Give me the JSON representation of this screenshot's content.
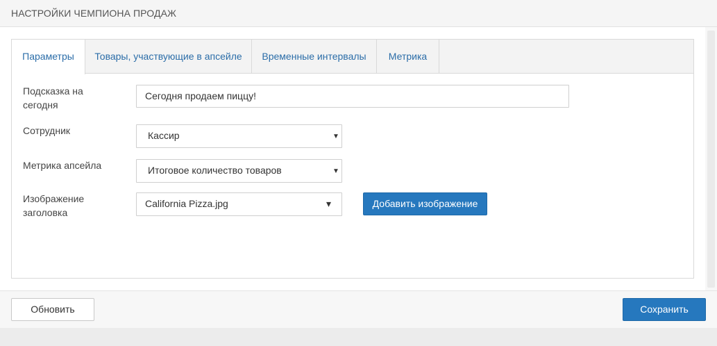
{
  "panel": {
    "title": "НАСТРОЙКИ ЧЕМПИОНА ПРОДАЖ"
  },
  "tabs": [
    {
      "label": "Параметры",
      "active": true
    },
    {
      "label": "Товары, участвующие в апсейле",
      "active": false
    },
    {
      "label": "Временные интервалы",
      "active": false
    },
    {
      "label": "Метрика",
      "active": false
    }
  ],
  "form": {
    "hint_label_line1": "Подсказка на",
    "hint_label_line2": "сегодня",
    "hint_value": "Сегодня продаем пиццу!",
    "employee_label": "Сотрудник",
    "employee_value": "Кассир",
    "metric_label": "Метрика апсейла",
    "metric_value": "Итоговое количество товаров",
    "image_label_line1": "Изображение",
    "image_label_line2": "заголовка",
    "image_value": "California Pizza.jpg",
    "add_image_label": "Добавить изображение"
  },
  "footer": {
    "refresh_label": "Обновить",
    "save_label": "Сохранить"
  },
  "icons": {
    "select_arrow": "▼",
    "dropdown_caret": "▾"
  },
  "colors": {
    "accent": "#2678be",
    "tab_text": "#2b6da8"
  }
}
